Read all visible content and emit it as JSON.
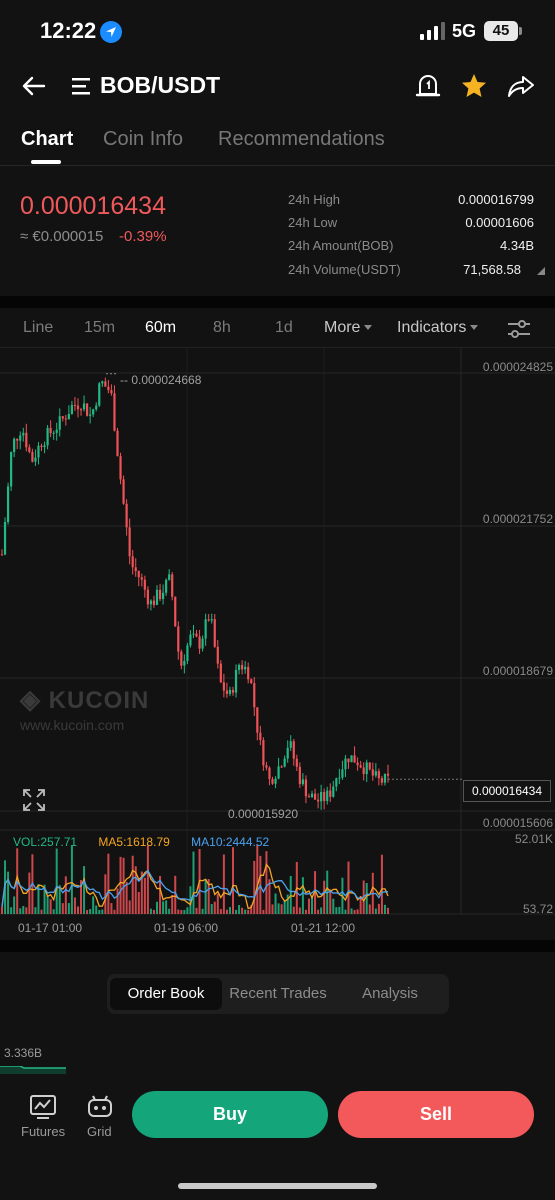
{
  "status_bar": {
    "time": "12:22",
    "network": "5G",
    "battery": "45"
  },
  "header": {
    "pair": "BOB/USDT",
    "icons": [
      "back-arrow-icon",
      "menu-icon",
      "price-alert-icon",
      "star-icon",
      "share-icon"
    ]
  },
  "tabs": [
    {
      "label": "Chart",
      "active": true
    },
    {
      "label": "Coin Info"
    },
    {
      "label": "Recommendations"
    }
  ],
  "ticker": {
    "last_price": "0.000016434",
    "fiat_price": "≈ €0.000015",
    "change": "-0.39%",
    "stats": [
      {
        "label": "24h High",
        "value": "0.000016799"
      },
      {
        "label": "24h Low",
        "value": "0.00001606"
      },
      {
        "label": "24h Amount(BOB)",
        "value": "4.34B"
      },
      {
        "label": "24h Volume(USDT)",
        "value": "71,568.58"
      }
    ]
  },
  "intervals": {
    "items": [
      "Line",
      "15m",
      "60m",
      "8h",
      "1d"
    ],
    "active": "60m",
    "more_label": "More",
    "indicators_label": "Indicators"
  },
  "chart": {
    "y_labels": [
      "0.000024825",
      "0.000021752",
      "0.000018679",
      "0.000015606"
    ],
    "high_marker": "0.000024668",
    "low_marker": "0.000015920",
    "current_price": "0.000016434",
    "volume_legend": {
      "vol": "VOL:257.71",
      "ma5": "MA5:1618.79",
      "ma10": "MA10:2444.52"
    },
    "volume_axis": [
      "52.01K",
      "53.72"
    ],
    "x_labels": [
      "01-17 01:00",
      "01-19 06:00",
      "01-21 12:00"
    ],
    "watermark_logo": "KUCOIN",
    "watermark_url": "www.kucoin.com",
    "colors": {
      "up": "#21b985",
      "down": "#ef5257",
      "ma5": "#f5a623",
      "ma10": "#4aa3f0"
    }
  },
  "chart_data": {
    "type": "candlestick",
    "x_labels": [
      "01-17 01:00",
      "01-19 06:00",
      "01-21 12:00"
    ],
    "y_tick_labels": [
      "0.000024825",
      "0.000021752",
      "0.000018679",
      "0.000015606"
    ],
    "price_range": [
      1.5606e-05,
      2.4825e-05
    ],
    "close_series": [
      2.1e-05,
      2.32e-05,
      2.36e-05,
      2.29e-05,
      2.33e-05,
      2.35e-05,
      2.37e-05,
      2.4e-05,
      2.41e-05,
      2.38e-05,
      2.45e-05,
      2.43e-05,
      2.25e-05,
      2.08e-05,
      2.05e-05,
      2e-05,
      2.02e-05,
      2.05e-05,
      1.87e-05,
      1.93e-05,
      1.92e-05,
      1.98e-05,
      1.84e-05,
      1.81e-05,
      1.88e-05,
      1.86e-05,
      1.72e-05,
      1.64e-05,
      1.67e-05,
      1.72e-05,
      1.65e-05,
      1.61e-05,
      1.6e-05,
      1.61e-05,
      1.66e-05,
      1.69e-05,
      1.68e-05,
      1.66e-05,
      1.64e-05,
      1.64e-05
    ],
    "high_marker": 2.4668e-05,
    "low_marker": 1.592e-05,
    "current_price": 1.6434e-05,
    "volume_axis": [
      "52.01K",
      "53.72"
    ],
    "indicators": [
      "VOL:257.71",
      "MA5:1618.79",
      "MA10:2444.52"
    ]
  },
  "orderbook_tabs": [
    {
      "label": "Order Book",
      "active": true
    },
    {
      "label": "Recent Trades"
    },
    {
      "label": "Analysis"
    }
  ],
  "depth": {
    "value": "3.336B"
  },
  "footer": {
    "futures_label": "Futures",
    "grid_label": "Grid",
    "buy_label": "Buy",
    "sell_label": "Sell"
  }
}
